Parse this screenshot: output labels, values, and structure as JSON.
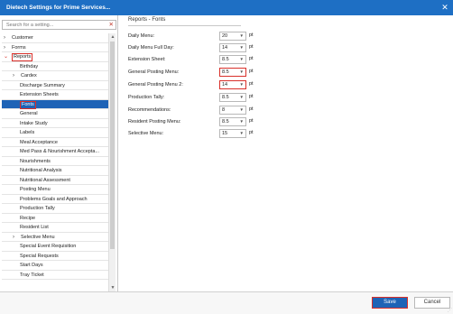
{
  "window": {
    "title": "Dietech Settings for Prime Services..."
  },
  "search": {
    "placeholder": "Search for a setting..."
  },
  "tree": {
    "top": [
      {
        "label": "Customer",
        "arrow": "›"
      },
      {
        "label": "Forms",
        "arrow": "›"
      },
      {
        "label": "Reports",
        "arrow": "⌄"
      }
    ],
    "children": [
      {
        "label": "Birthday",
        "arrow": ""
      },
      {
        "label": "Cardex",
        "arrow": "›"
      },
      {
        "label": "Discharge Summary",
        "arrow": ""
      },
      {
        "label": "Extension Sheets",
        "arrow": ""
      },
      {
        "label": "Fonts",
        "arrow": ""
      },
      {
        "label": "General",
        "arrow": ""
      },
      {
        "label": "Intake Study",
        "arrow": ""
      },
      {
        "label": "Labels",
        "arrow": ""
      },
      {
        "label": "Meal Acceptance",
        "arrow": ""
      },
      {
        "label": "Med Pass & Nourishment Accepta...",
        "arrow": ""
      },
      {
        "label": "Nourishments",
        "arrow": ""
      },
      {
        "label": "Nutritional Analysis",
        "arrow": ""
      },
      {
        "label": "Nutritional Assessment",
        "arrow": ""
      },
      {
        "label": "Posting Menu",
        "arrow": ""
      },
      {
        "label": "Problems Goals and Approach",
        "arrow": ""
      },
      {
        "label": "Production Tally",
        "arrow": ""
      },
      {
        "label": "Recipe",
        "arrow": ""
      },
      {
        "label": "Resident List",
        "arrow": ""
      },
      {
        "label": "Selective Menu",
        "arrow": "›"
      },
      {
        "label": "Special Event Requisition",
        "arrow": ""
      },
      {
        "label": "Special Requests",
        "arrow": ""
      },
      {
        "label": "Start Days",
        "arrow": ""
      },
      {
        "label": "Tray Ticket",
        "arrow": ""
      }
    ]
  },
  "panel": {
    "heading": "Reports - Fonts",
    "settings": [
      {
        "label": "Daily Menu:",
        "value": "20",
        "unit": "pt"
      },
      {
        "label": "Daily Menu Full Day:",
        "value": "14",
        "unit": "pt"
      },
      {
        "label": "Extension Sheet:",
        "value": "8.5",
        "unit": "pt"
      },
      {
        "label": "General Posting Menu:",
        "value": "8.5",
        "unit": "pt"
      },
      {
        "label": "General Posting Menu 2:",
        "value": "14",
        "unit": "pt"
      },
      {
        "label": "Production Tally:",
        "value": "8.5",
        "unit": "pt"
      },
      {
        "label": "Recommendations:",
        "value": "8",
        "unit": "pt"
      },
      {
        "label": "Resident Posting Menu:",
        "value": "8.5",
        "unit": "pt"
      },
      {
        "label": "Selective Menu:",
        "value": "15",
        "unit": "pt"
      }
    ]
  },
  "footer": {
    "save_label": "Save",
    "cancel_label": "Cancel"
  },
  "icons": {
    "close": "close-icon",
    "clear": "clear-icon",
    "chevron": "chevron-down-icon"
  },
  "colors": {
    "titlebar": "#1e6fc4",
    "selection": "#1e63b6",
    "highlight": "#d9302a"
  }
}
